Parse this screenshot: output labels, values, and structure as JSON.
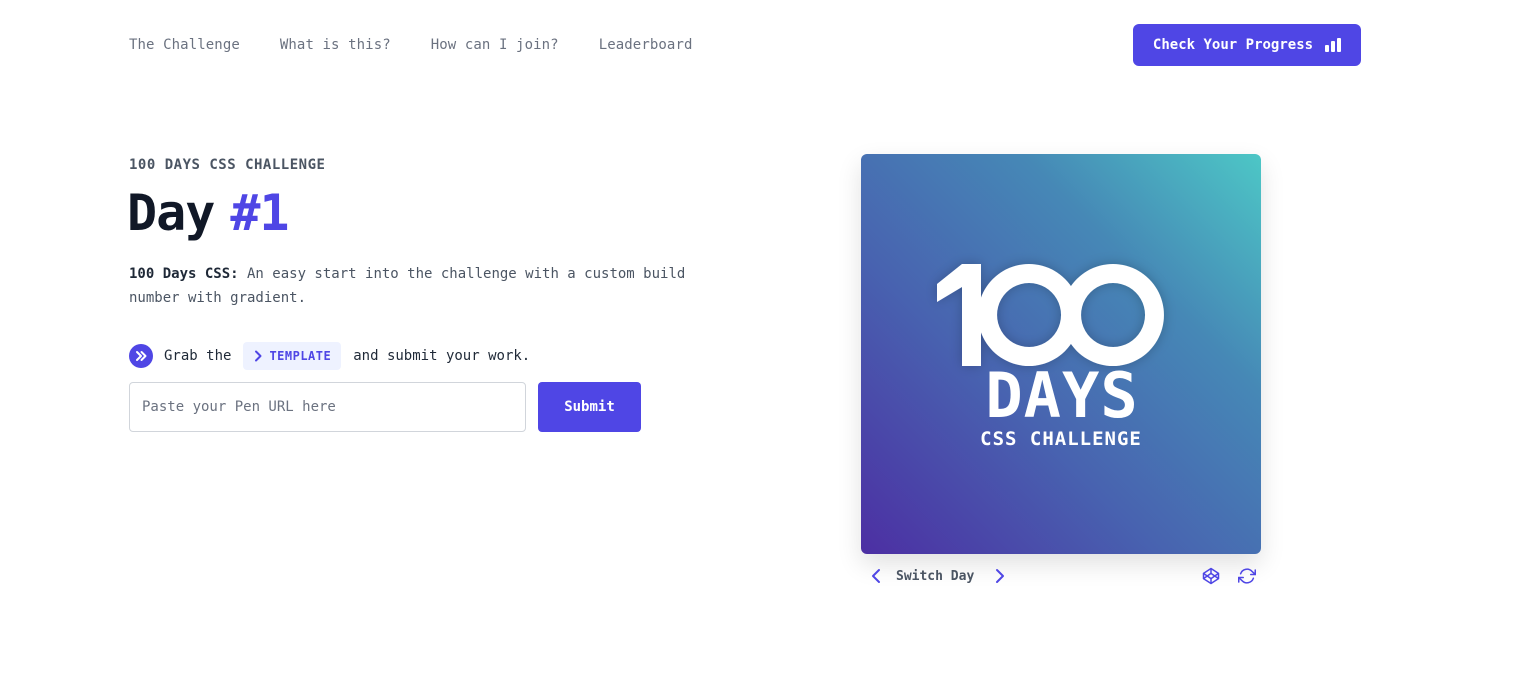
{
  "nav": {
    "links": [
      "The Challenge",
      "What is this?",
      "How can I join?",
      "Leaderboard"
    ],
    "progress_button": "Check Your Progress"
  },
  "hero": {
    "eyebrow": "100 DAYS CSS CHALLENGE",
    "title_prefix": "Day",
    "day_number": "#1",
    "description_lead": "100 Days CSS:",
    "description_text": " An easy start into the challenge with a custom build number with gradient.",
    "grab_before": "Grab the",
    "template_label": "TEMPLATE",
    "grab_after": "and submit your work.",
    "input_placeholder": "Paste your Pen URL here",
    "submit_label": "Submit"
  },
  "preview": {
    "big_number": "100",
    "days_word": "DAYS",
    "subtitle": "CSS CHALLENGE",
    "switch_label": "Switch Day"
  },
  "colors": {
    "accent": "#4f46e5",
    "gradient_start": "#4c2fa3",
    "gradient_end": "#4dc7c6"
  },
  "icons": [
    "bar-chart-icon",
    "double-chevron-right-icon",
    "chevron-right-icon",
    "chevron-left-icon",
    "codepen-icon",
    "refresh-icon"
  ]
}
